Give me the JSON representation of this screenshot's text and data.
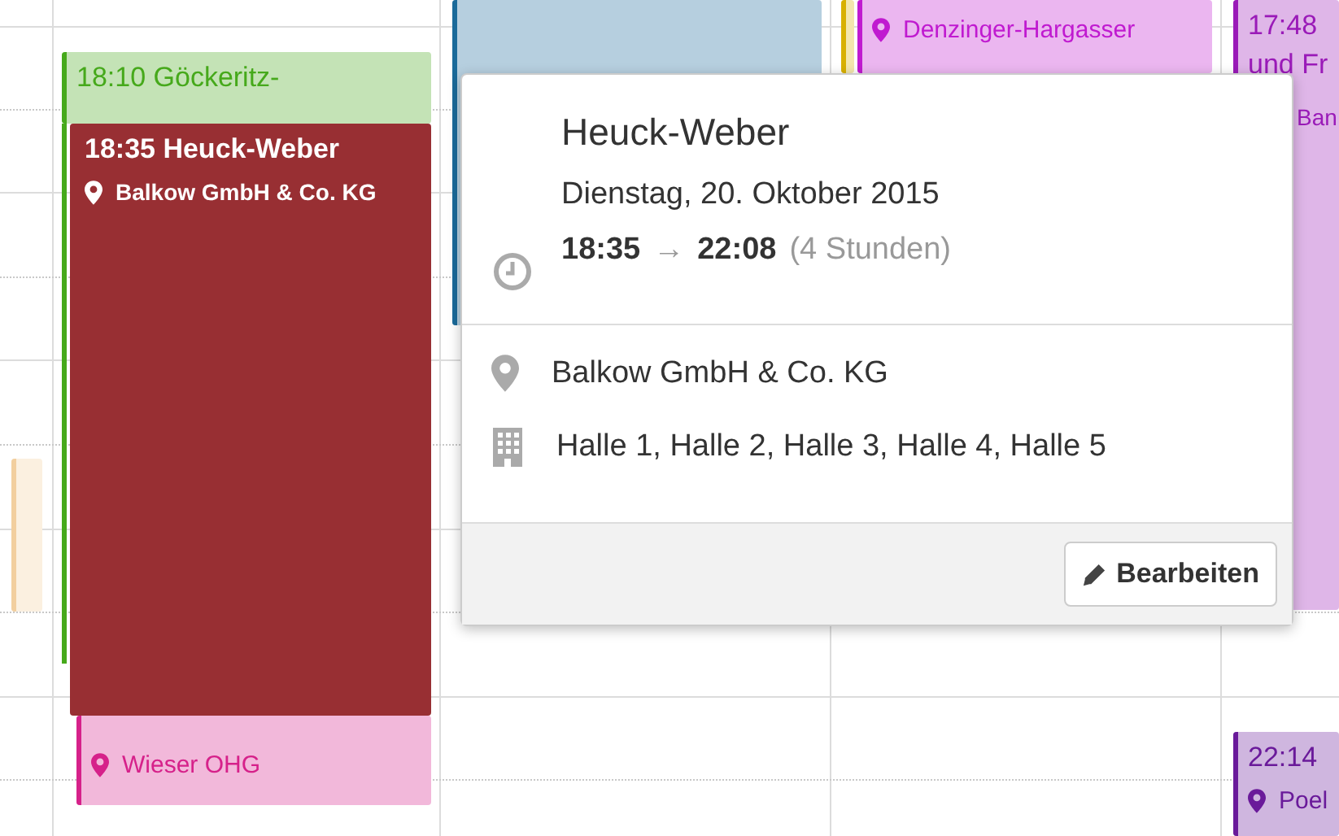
{
  "events": [
    {
      "color": "#f2cf9f",
      "selected": false
    },
    {
      "title": "18:10 Göckeritz-",
      "color": "#46a91b",
      "selected": false
    },
    {
      "title": "18:35 Heuck-Weber",
      "location": "Balkow GmbH & Co. KG",
      "color": "#982f33",
      "selected": true
    },
    {
      "location": "Wieser OHG",
      "color": "#d6218a",
      "selected": false
    },
    {
      "color": "#1a6a9a",
      "selected": false
    },
    {
      "color": "#d8b000",
      "selected": false
    },
    {
      "location": "Denzinger-Hargasser",
      "color": "#c01ad0",
      "selected": false
    },
    {
      "title": "17:48 und Fr",
      "location": "Ban",
      "color": "#9a1ab8",
      "selected": false
    },
    {
      "title": "22:14",
      "location": "Poel",
      "color": "#6a1a9a",
      "selected": false
    }
  ],
  "popover": {
    "title": "Heuck-Weber",
    "date": "Dienstag, 20. Oktober 2015",
    "start": "18:35",
    "arrow": "→",
    "end": "22:08",
    "duration": "(4 Stunden)",
    "location": "Balkow GmbH & Co. KG",
    "rooms": "Halle 1, Halle 2, Halle 3, Halle 4, Halle 5",
    "edit_button": "Bearbeiten"
  }
}
